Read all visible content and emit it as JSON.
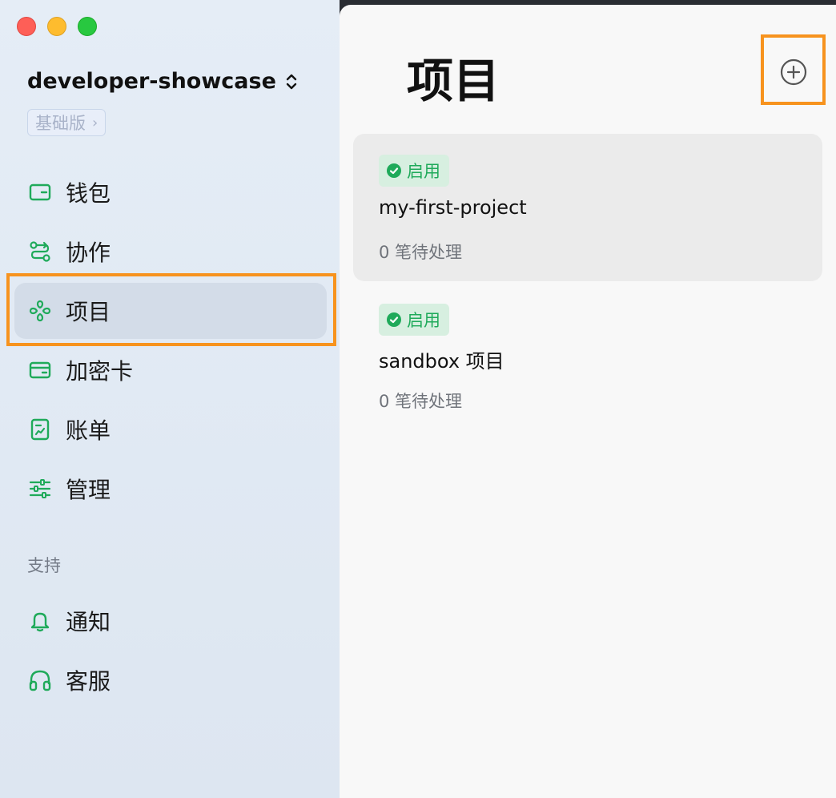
{
  "sidebar": {
    "account_name": "developer-showcase",
    "plan": "基础版",
    "nav": [
      {
        "label": "钱包",
        "icon": "wallet-icon"
      },
      {
        "label": "协作",
        "icon": "route-icon"
      },
      {
        "label": "项目",
        "icon": "project-icon",
        "active": true
      },
      {
        "label": "加密卡",
        "icon": "card-icon"
      },
      {
        "label": "账单",
        "icon": "bill-icon"
      },
      {
        "label": "管理",
        "icon": "sliders-icon"
      }
    ],
    "support_label": "支持",
    "support": [
      {
        "label": "通知",
        "icon": "bell-icon"
      },
      {
        "label": "客服",
        "icon": "headphones-icon"
      }
    ]
  },
  "main": {
    "title": "项目",
    "add_button_icon": "plus-circle-icon",
    "projects": [
      {
        "status": "启用",
        "name": "my-first-project",
        "pending": "0 笔待处理",
        "selected": true
      },
      {
        "status": "启用",
        "name": "sandbox 项目",
        "pending": "0 笔待处理",
        "selected": false
      }
    ]
  },
  "colors": {
    "accent_green": "#1faa5a",
    "highlight_orange": "#f7931e",
    "sidebar_bg": "#e3ebf5",
    "main_bg": "#f8f8f8"
  }
}
